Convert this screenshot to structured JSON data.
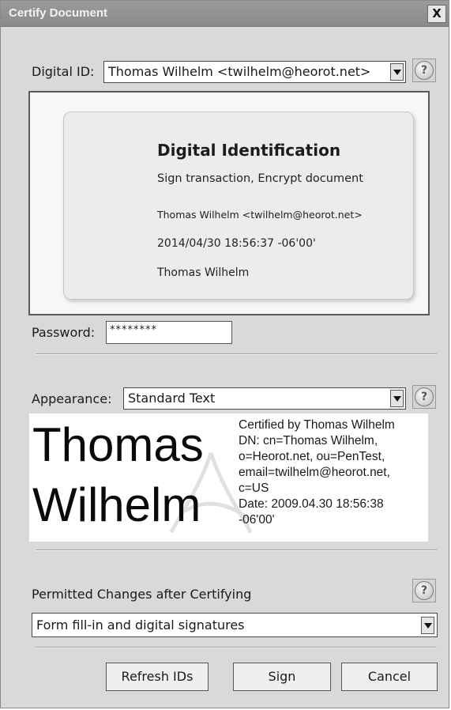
{
  "window": {
    "title": "Certify Document",
    "close_glyph": "X"
  },
  "digital_id": {
    "label": "Digital ID:",
    "selected": "Thomas Wilhelm <twilhelm@heorot.net>"
  },
  "id_card": {
    "title": "Digital Identification",
    "usage": "Sign transaction, Encrypt document",
    "identity": "Thomas Wilhelm <twilhelm@heorot.net>",
    "timestamp": "2014/04/30 18:56:37 -06'00'",
    "name": "Thomas Wilhelm"
  },
  "password": {
    "label": "Password:",
    "value": "********"
  },
  "appearance": {
    "label": "Appearance:",
    "selected": "Standard Text",
    "preview": {
      "name_line1": "Thomas",
      "name_line2": "Wilhelm",
      "details": [
        "Certified by Thomas Wilhelm",
        "DN: cn=Thomas Wilhelm,",
        "o=Heorot.net, ou=PenTest,",
        "email=twilhelm@heorot.net,",
        "c=US",
        "Date: 2009.04.30 18:56:38",
        "-06'00'"
      ]
    }
  },
  "permitted_changes": {
    "label": "Permitted Changes after Certifying",
    "selected": "Form fill-in and digital signatures"
  },
  "help_glyph": "?",
  "buttons": {
    "refresh": "Refresh IDs",
    "sign": "Sign",
    "cancel": "Cancel"
  },
  "icons": [
    "close-icon",
    "help-icon",
    "dropdown-arrow-icon",
    "adobe-watermark-icon"
  ]
}
